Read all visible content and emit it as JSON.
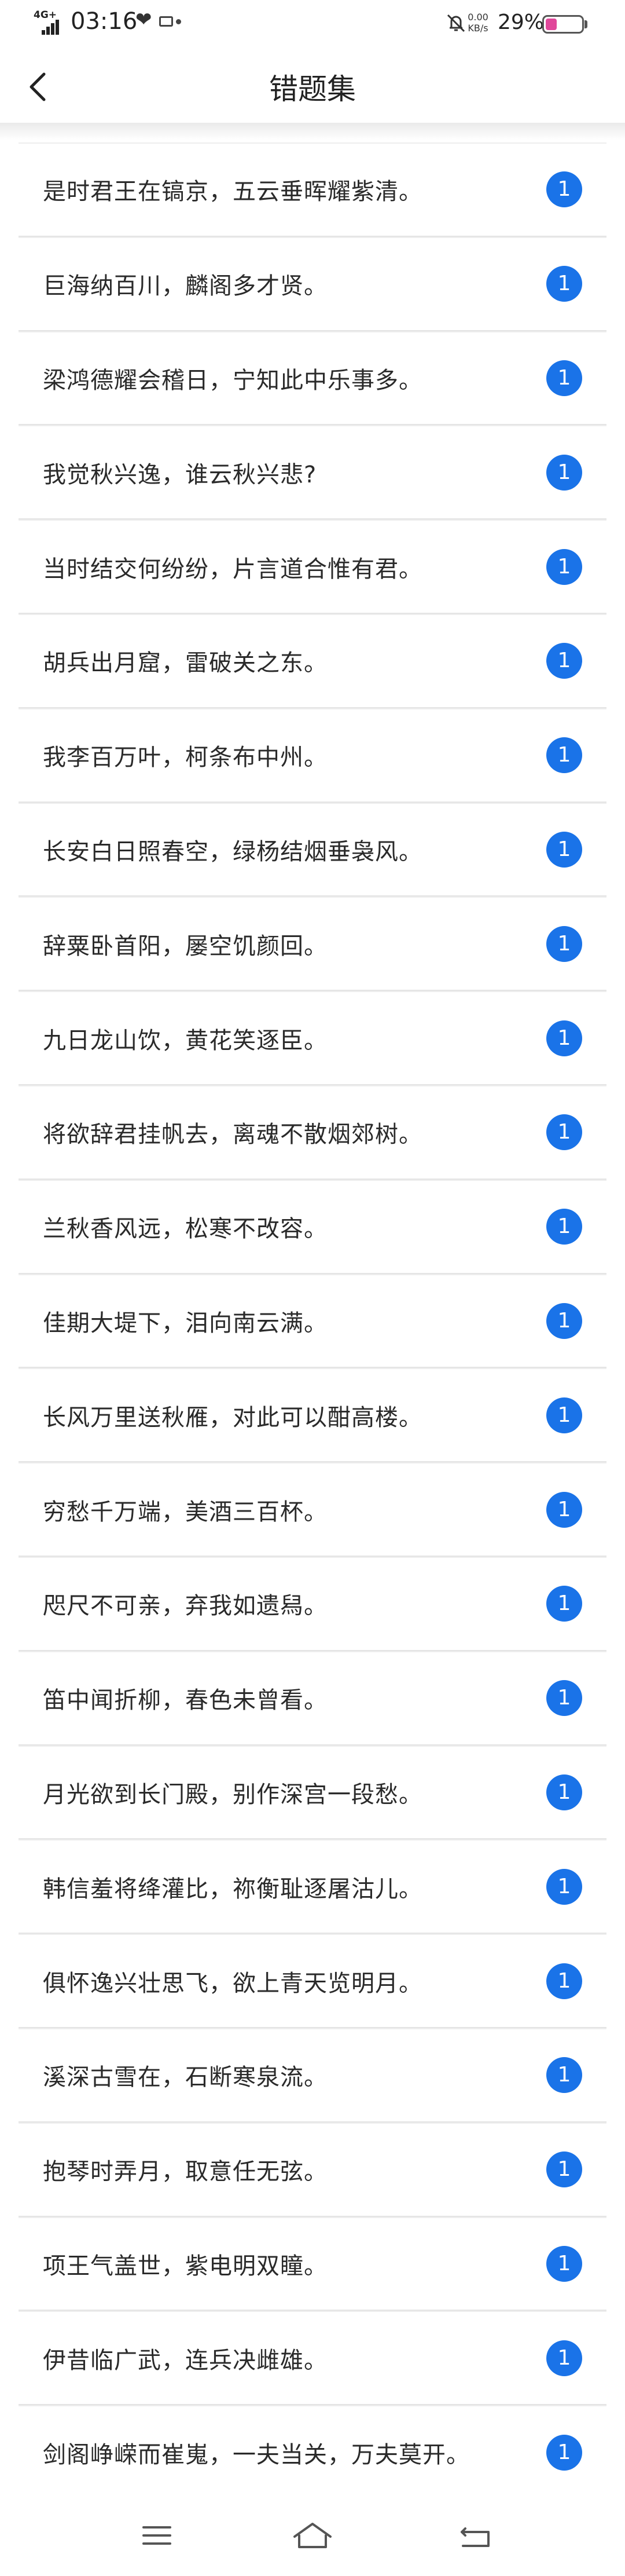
{
  "status_bar": {
    "network": "4G+",
    "time": "03:16",
    "speed_value": "0.00",
    "speed_unit": "KB/s",
    "battery_text": "29%",
    "battery_level": 0.29,
    "battery_color": "#e0479a"
  },
  "header": {
    "title": "错题集"
  },
  "badge_color": "#1a73e8",
  "items": [
    {
      "text": "是时君王在镐京，五云垂晖耀紫清。",
      "count": "1"
    },
    {
      "text": "巨海纳百川，麟阁多才贤。",
      "count": "1"
    },
    {
      "text": "梁鸿德耀会稽日，宁知此中乐事多。",
      "count": "1"
    },
    {
      "text": "我觉秋兴逸，谁云秋兴悲?",
      "count": "1"
    },
    {
      "text": "当时结交何纷纷，片言道合惟有君。",
      "count": "1"
    },
    {
      "text": "胡兵出月窟，雷破关之东。",
      "count": "1"
    },
    {
      "text": "我李百万叶，柯条布中州。",
      "count": "1"
    },
    {
      "text": "长安白日照春空，绿杨结烟垂袅风。",
      "count": "1"
    },
    {
      "text": "辞粟卧首阳，屡空饥颜回。",
      "count": "1"
    },
    {
      "text": "九日龙山饮，黄花笑逐臣。",
      "count": "1"
    },
    {
      "text": "将欲辞君挂帆去，离魂不散烟郊树。",
      "count": "1"
    },
    {
      "text": "兰秋香风远，松寒不改容。",
      "count": "1"
    },
    {
      "text": "佳期大堤下，泪向南云满。",
      "count": "1"
    },
    {
      "text": "长风万里送秋雁，对此可以酣高楼。",
      "count": "1"
    },
    {
      "text": "穷愁千万端，美酒三百杯。",
      "count": "1"
    },
    {
      "text": "咫尺不可亲，弃我如遗舄。",
      "count": "1"
    },
    {
      "text": "笛中闻折柳，春色未曾看。",
      "count": "1"
    },
    {
      "text": "月光欲到长门殿，别作深宫一段愁。",
      "count": "1"
    },
    {
      "text": "韩信羞将绛灌比，祢衡耻逐屠沽儿。",
      "count": "1"
    },
    {
      "text": "俱怀逸兴壮思飞，欲上青天览明月。",
      "count": "1"
    },
    {
      "text": "溪深古雪在，石断寒泉流。",
      "count": "1"
    },
    {
      "text": "抱琴时弄月，取意任无弦。",
      "count": "1"
    },
    {
      "text": "项王气盖世，紫电明双瞳。",
      "count": "1"
    },
    {
      "text": "伊昔临广武，连兵决雌雄。",
      "count": "1"
    },
    {
      "text": "剑阁峥嵘而崔嵬，一夫当关，万夫莫开。",
      "count": "1"
    }
  ],
  "icons": {
    "back": "chevron-left-icon",
    "menu": "menu-icon",
    "home": "home-icon",
    "return": "return-icon"
  }
}
